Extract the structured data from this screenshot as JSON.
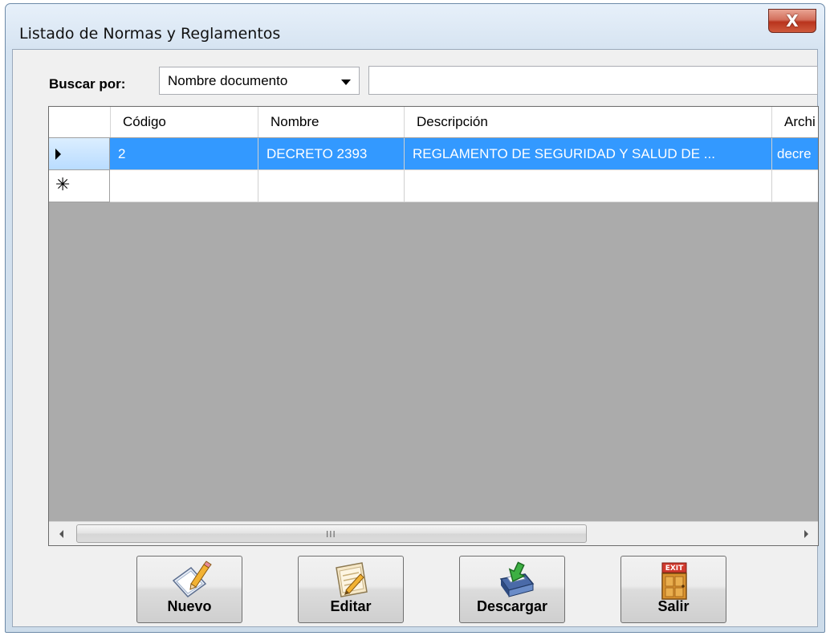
{
  "window": {
    "title": "Listado de Normas y Reglamentos",
    "close_glyph": "X"
  },
  "search": {
    "label": "Buscar por:",
    "selected_option": "Nombre documento",
    "text_value": ""
  },
  "grid": {
    "columns": [
      "Código",
      "Nombre",
      "Descripción",
      "Archi"
    ],
    "rows": [
      {
        "selected": true,
        "row_marker": "current-row-arrow",
        "cells": [
          "2",
          "DECRETO 2393",
          "REGLAMENTO DE SEGURIDAD Y SALUD DE ...",
          "decre"
        ]
      },
      {
        "selected": false,
        "row_marker": "new-row-asterisk",
        "marker_glyph": "✳",
        "cells": [
          "",
          "",
          "",
          ""
        ]
      }
    ],
    "scroll_grip": "III",
    "empty_area_color": "#ababab",
    "selection_color": "#3399ff"
  },
  "buttons": [
    {
      "label": "Nuevo",
      "icon": "new-document-pencil-icon"
    },
    {
      "label": "Editar",
      "icon": "edit-document-icon"
    },
    {
      "label": "Descargar",
      "icon": "download-printer-icon"
    },
    {
      "label": "Salir",
      "icon": "exit-door-icon",
      "icon_text": "EXIT"
    }
  ]
}
